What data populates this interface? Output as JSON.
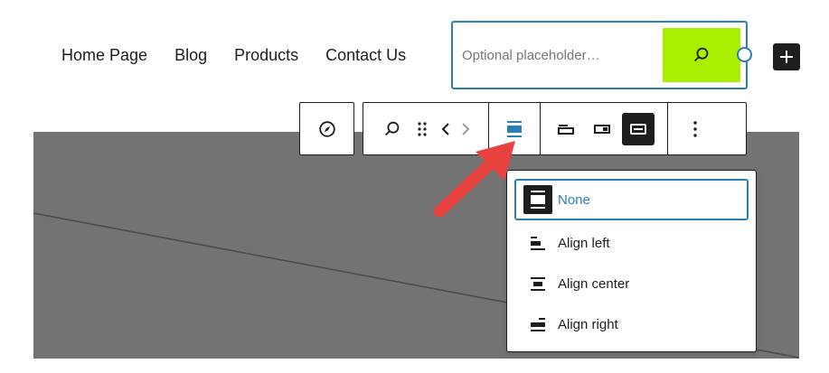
{
  "nav": {
    "items": [
      "Home Page",
      "Blog",
      "Products",
      "Contact Us"
    ]
  },
  "search": {
    "placeholder": "Optional placeholder…",
    "button_icon": "search-icon",
    "button_color": "#a9f000"
  },
  "toolbar": {
    "groups": [
      [
        "compass-icon"
      ],
      [
        "search-icon",
        "drag-handle-icon",
        "move-left-icon",
        "move-right-icon",
        "justification-icon"
      ],
      [
        "button-outside-icon",
        "button-inside-icon",
        "no-button-icon"
      ],
      [
        "more-options-icon"
      ]
    ]
  },
  "alignment_menu": {
    "items": [
      {
        "label": "None",
        "icon": "align-none-icon",
        "selected": true
      },
      {
        "label": "Align left",
        "icon": "align-left-icon",
        "selected": false
      },
      {
        "label": "Align center",
        "icon": "align-center-icon",
        "selected": false
      },
      {
        "label": "Align right",
        "icon": "align-right-icon",
        "selected": false
      }
    ]
  },
  "colors": {
    "accent": "#2a7fb6",
    "annotation_arrow": "#e8423f",
    "image_background": "#737373"
  }
}
